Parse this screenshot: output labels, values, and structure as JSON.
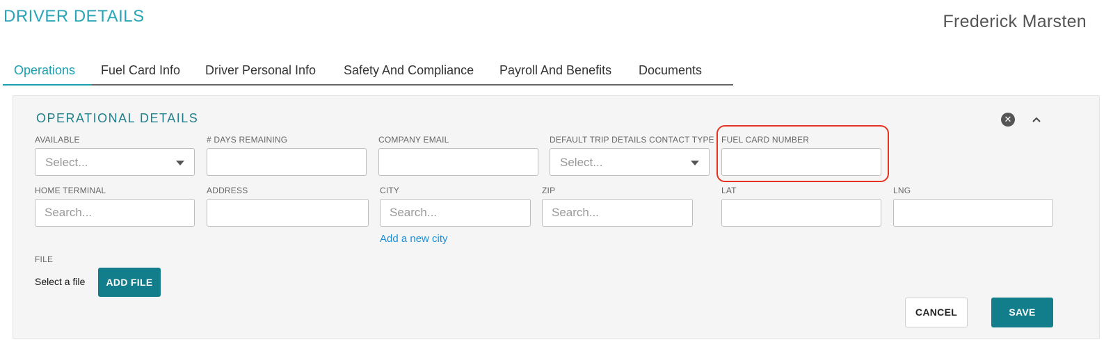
{
  "header": {
    "title": "DRIVER DETAILS",
    "driver_name": "Frederick Marsten"
  },
  "tabs": [
    {
      "label": "Operations",
      "active": true
    },
    {
      "label": "Fuel Card Info",
      "active": false
    },
    {
      "label": "Driver Personal Info",
      "active": false
    },
    {
      "label": "Safety And Compliance",
      "active": false
    },
    {
      "label": "Payroll And Benefits",
      "active": false
    },
    {
      "label": "Documents",
      "active": false
    }
  ],
  "section": {
    "title": "OPERATIONAL DETAILS",
    "close_icon": "close-circle-icon",
    "collapse_icon": "chevron-up-icon"
  },
  "fields": {
    "available": {
      "label": "AVAILABLE",
      "placeholder": "Select...",
      "value": ""
    },
    "days_remaining": {
      "label": "# DAYS REMAINING",
      "value": ""
    },
    "company_email": {
      "label": "COMPANY EMAIL",
      "value": ""
    },
    "default_trip_contact": {
      "label": "DEFAULT TRIP DETAILS CONTACT TYPE",
      "placeholder": "Select...",
      "value": ""
    },
    "fuel_card_number": {
      "label": "FUEL CARD NUMBER",
      "value": ""
    },
    "home_terminal": {
      "label": "HOME TERMINAL",
      "placeholder": "Search...",
      "value": ""
    },
    "address": {
      "label": "ADDRESS",
      "value": ""
    },
    "city": {
      "label": "CITY",
      "placeholder": "Search...",
      "value": ""
    },
    "zip": {
      "label": "ZIP",
      "placeholder": "Search...",
      "value": ""
    },
    "lat": {
      "label": "LAT",
      "value": ""
    },
    "lng": {
      "label": "LNG",
      "value": ""
    }
  },
  "links": {
    "add_city": "Add a new city"
  },
  "file": {
    "label": "FILE",
    "select_text": "Select a file",
    "add_button": "ADD FILE"
  },
  "actions": {
    "cancel": "CANCEL",
    "save": "SAVE"
  },
  "colors": {
    "accent": "#2aa5b8",
    "primary_button": "#137e8b",
    "highlight": "#e53321",
    "link": "#1a8fd8"
  }
}
